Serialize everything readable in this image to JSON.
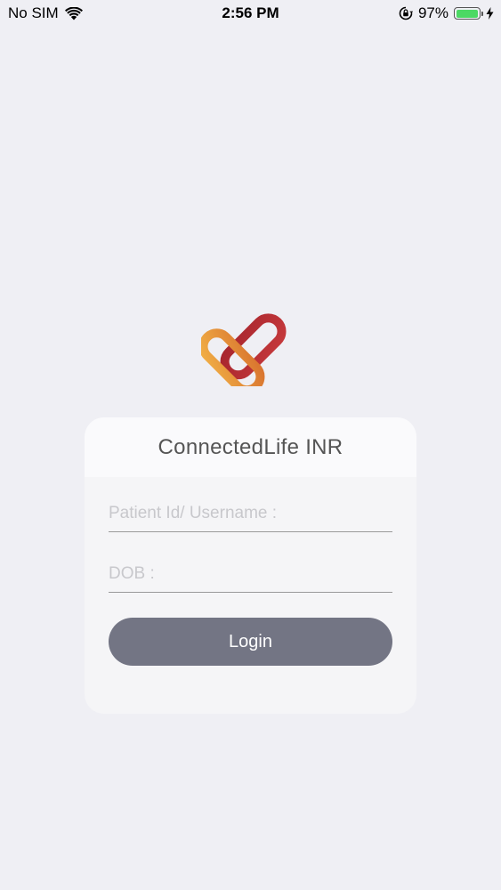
{
  "status_bar": {
    "carrier": "No SIM",
    "time": "2:56 PM",
    "battery_percent": "97%",
    "battery_level": 0.97,
    "icons": [
      "wifi-icon",
      "orientation-lock-icon",
      "battery-icon",
      "charging-bolt-icon"
    ]
  },
  "app": {
    "logo_icon": "connectedlife-heart-logo",
    "logo_colors": [
      "#e59a3c",
      "#c0393c"
    ],
    "title": "ConnectedLife INR"
  },
  "form": {
    "username_placeholder": "Patient Id/ Username :",
    "dob_placeholder": "DOB :",
    "login_label": "Login",
    "button_color": "#737584"
  }
}
